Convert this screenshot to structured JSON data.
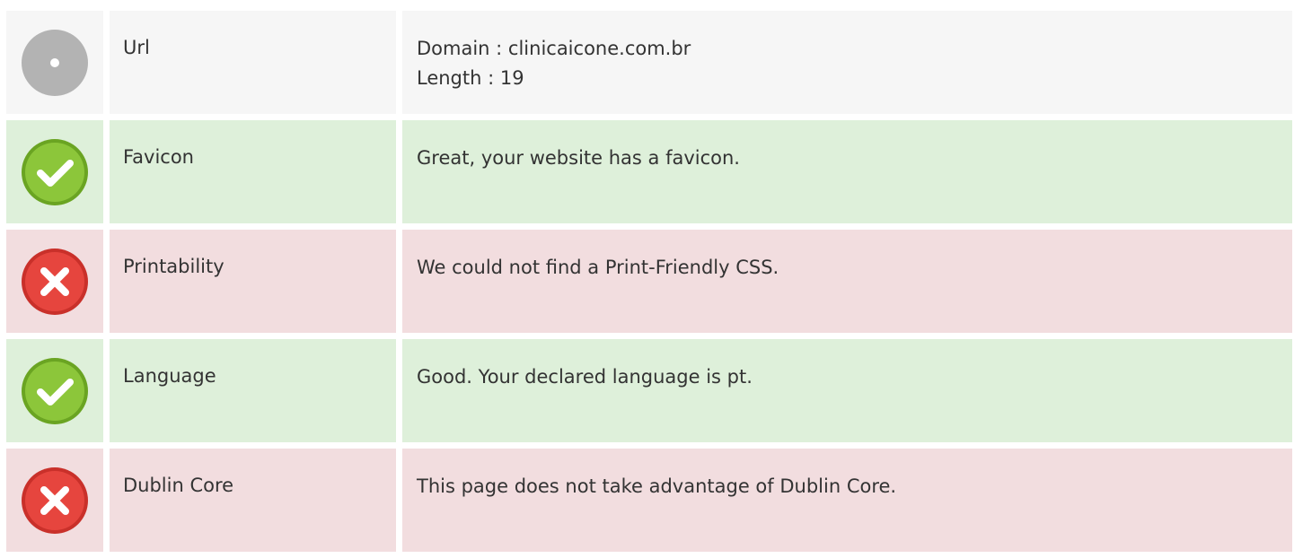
{
  "colors": {
    "neutral_bg": "#f6f6f6",
    "pass_bg": "#def0da",
    "fail_bg": "#f2dddf",
    "pass_icon": "#7cb82f",
    "fail_icon": "#e0403a",
    "neutral_icon": "#b3b3b3"
  },
  "rows": [
    {
      "status": "neutral",
      "icon": "neutral-circle-icon",
      "label": "Url",
      "lines": [
        "Domain : clinicaicone.com.br",
        "Length : 19"
      ]
    },
    {
      "status": "pass",
      "icon": "check-icon",
      "label": "Favicon",
      "lines": [
        "Great, your website has a favicon."
      ]
    },
    {
      "status": "fail",
      "icon": "cross-icon",
      "label": "Printability",
      "lines": [
        "We could not find a Print-Friendly CSS."
      ]
    },
    {
      "status": "pass",
      "icon": "check-icon",
      "label": "Language",
      "lines": [
        "Good. Your declared language is pt."
      ]
    },
    {
      "status": "fail",
      "icon": "cross-icon",
      "label": "Dublin Core",
      "lines": [
        "This page does not take advantage of Dublin Core."
      ]
    }
  ]
}
